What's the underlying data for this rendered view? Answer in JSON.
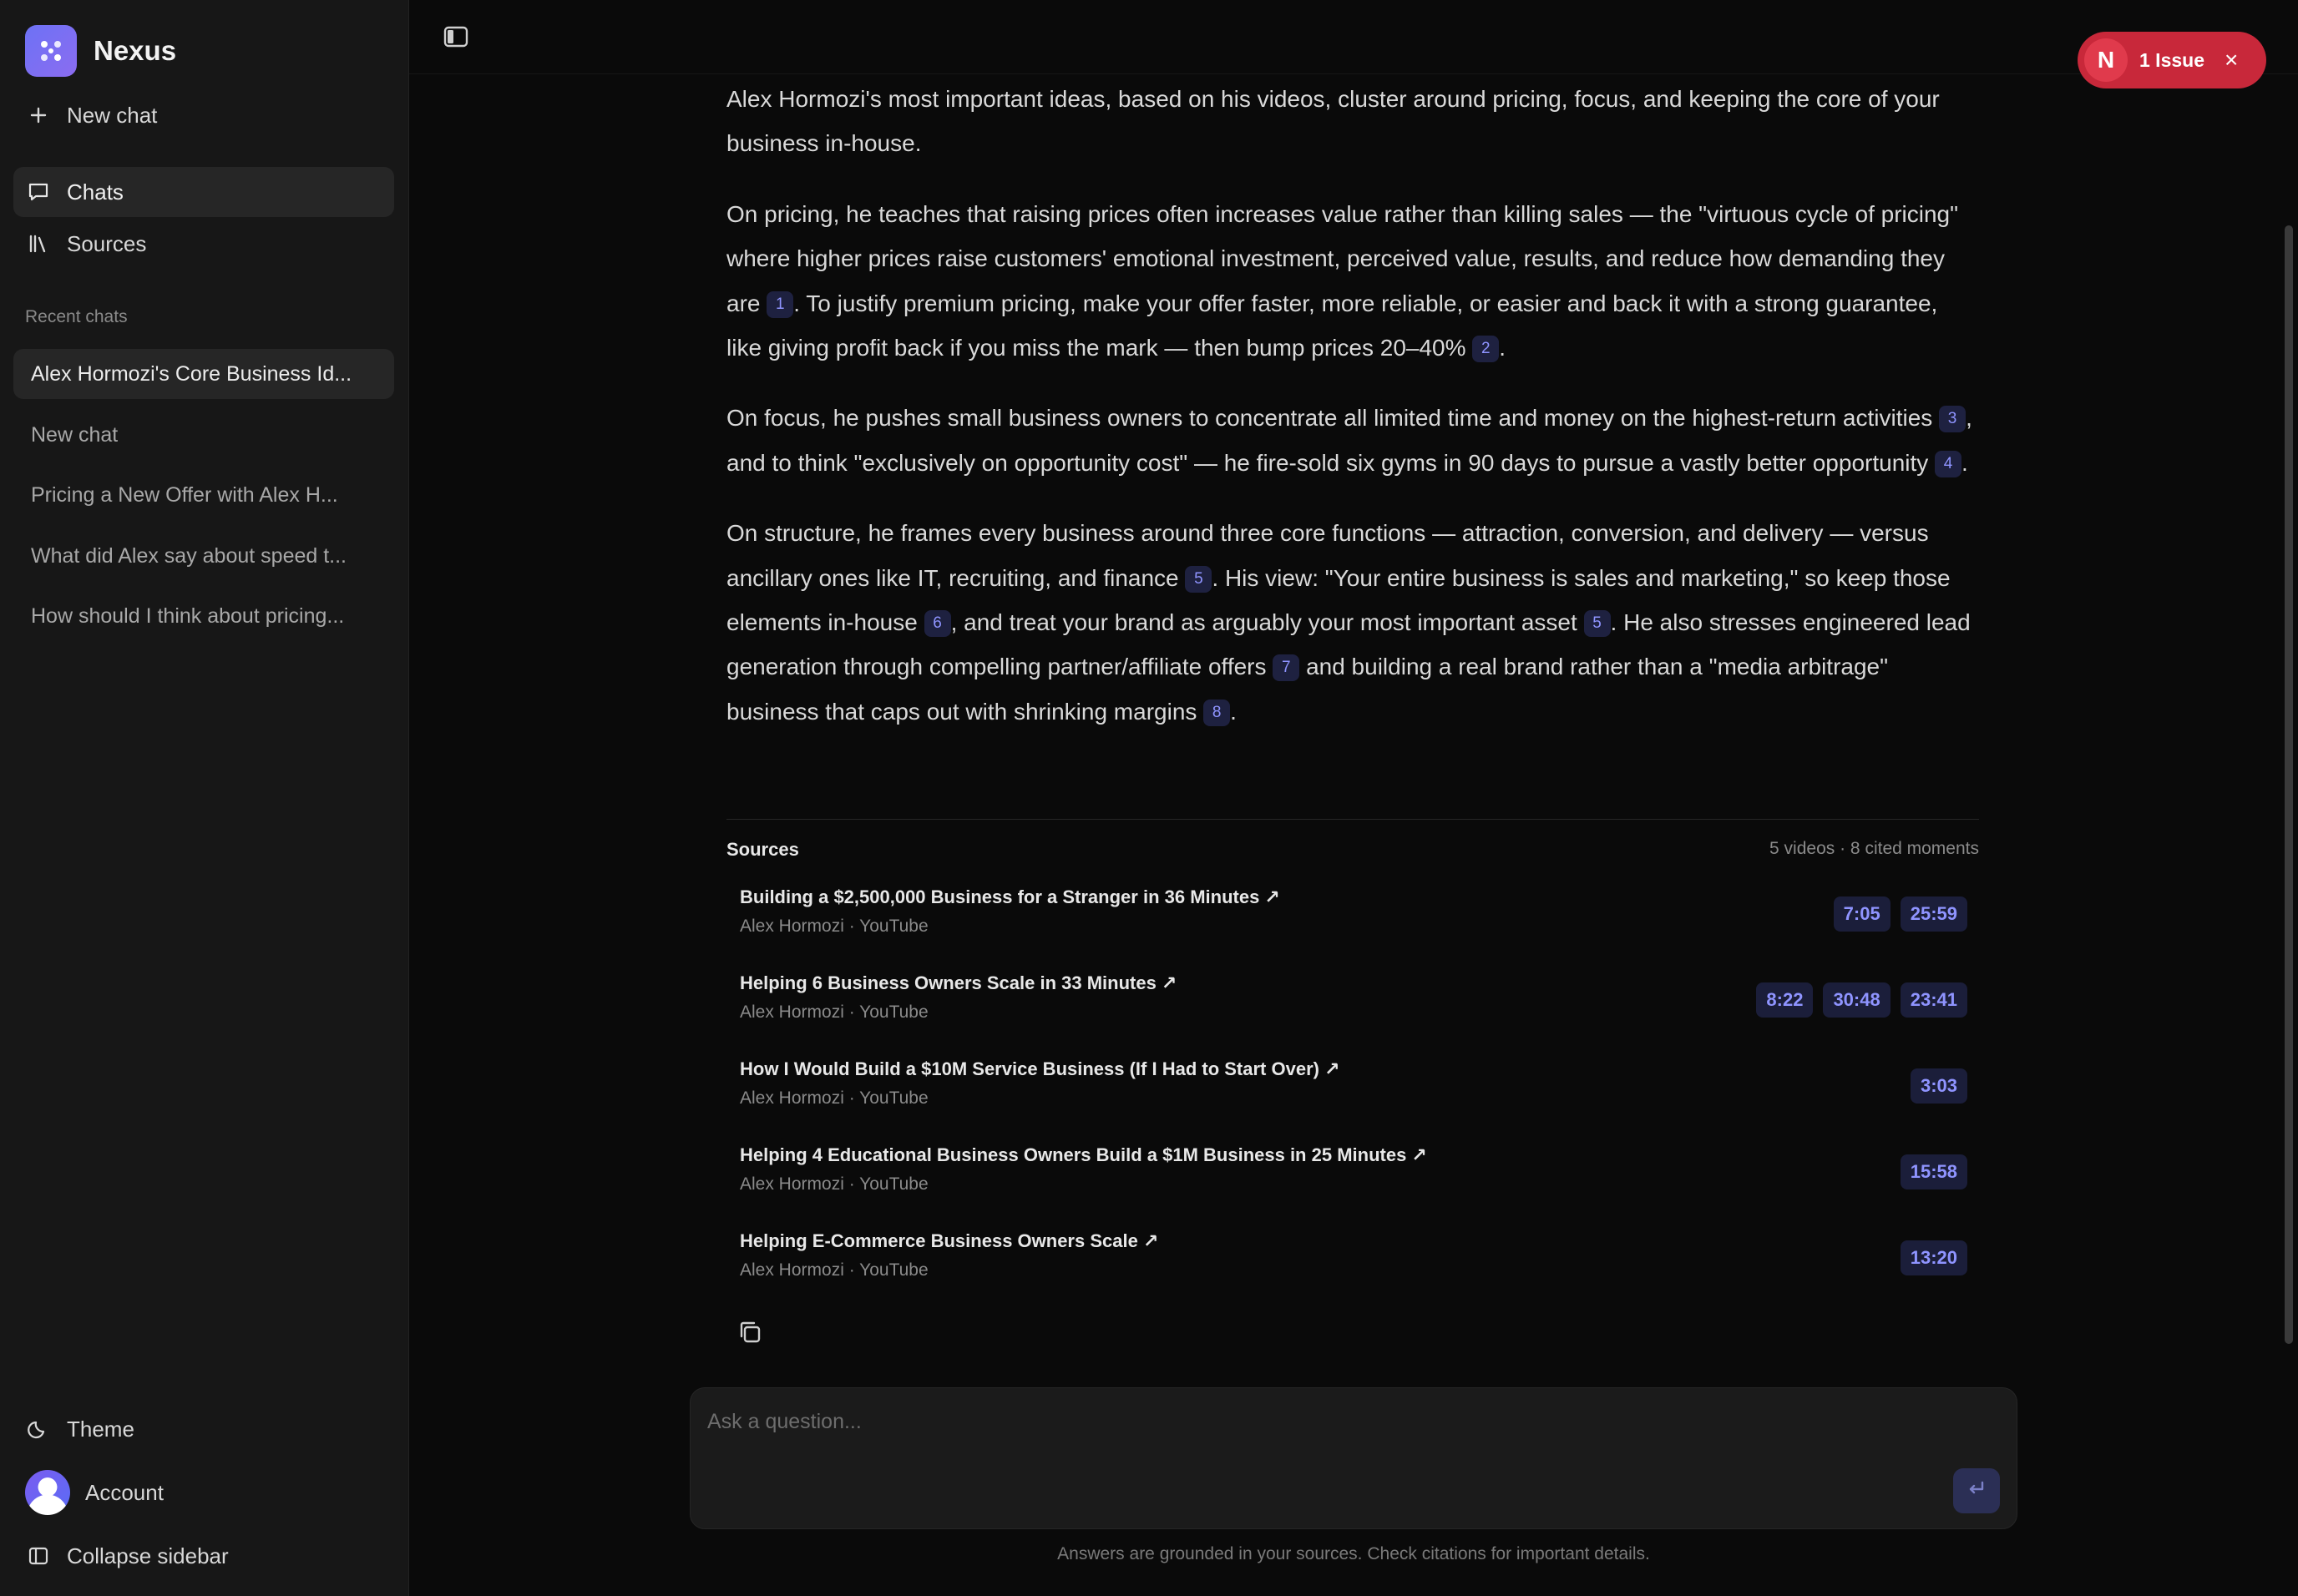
{
  "sidebar": {
    "brand": "Nexus",
    "new_chat": "New chat",
    "nav": [
      {
        "label": "Chats"
      },
      {
        "label": "Sources"
      }
    ],
    "recent_label": "Recent chats",
    "recent": [
      "Alex Hormozi's Core Business Id...",
      "New chat",
      "Pricing a New Offer with Alex H...",
      "What did Alex say about speed t...",
      "How should I think about pricing..."
    ],
    "theme": "Theme",
    "account": "Account",
    "collapse": "Collapse sidebar"
  },
  "issue_badge": {
    "initial": "N",
    "text": "1 Issue",
    "close": "×",
    "color": "#c8283a"
  },
  "answer": {
    "p1": "Alex Hormozi's most important ideas, based on his videos, cluster around pricing, focus, and keeping the core of your business in-house.",
    "p2": [
      "On pricing, he teaches that raising prices often increases value rather than killing sales — the \"virtuous cycle of pricing\" where higher prices raise customers' emotional investment, perceived value, results, and reduce how demanding they are",
      "1",
      ". To justify premium pricing, make your offer faster, more reliable, or easier and back it with a strong guarantee, like giving profit back if you miss the mark — then bump prices 20–40%",
      "2",
      "."
    ],
    "p3": [
      "On focus, he pushes small business owners to concentrate all limited time and money on the highest-return activities",
      "3",
      ", and to think \"exclusively on opportunity cost\" — he fire-sold six gyms in 90 days to pursue a vastly better opportunity",
      "4",
      "."
    ],
    "p4": [
      "On structure, he frames every business around three core functions — attraction, conversion, and delivery — versus ancillary ones like IT, recruiting, and finance",
      "5",
      ". His view: \"Your entire business is sales and marketing,\" so keep those elements in-house",
      "6",
      ", and treat your brand as arguably your most important asset",
      "5",
      ". He also stresses engineered lead generation through compelling partner/affiliate offers",
      "7",
      "and building a real brand rather than a \"media arbitrage\" business that caps out with shrinking margins",
      "8",
      "."
    ]
  },
  "sources": {
    "title": "Sources",
    "meta": "5 videos · 8 cited moments",
    "items": [
      {
        "title": "Building a $2,500,000 Business for a Stranger in 36 Minutes ↗",
        "sub": "Alex Hormozi · YouTube",
        "ts": [
          "7:05",
          "25:59"
        ]
      },
      {
        "title": "Helping 6 Business Owners Scale in 33 Minutes ↗",
        "sub": "Alex Hormozi · YouTube",
        "ts": [
          "8:22",
          "30:48",
          "23:41"
        ]
      },
      {
        "title": "How I Would Build a $10M Service Business (If I Had to Start Over) ↗",
        "sub": "Alex Hormozi · YouTube",
        "ts": [
          "3:03"
        ]
      },
      {
        "title": "Helping 4 Educational Business Owners Build a $1M Business in 25 Minutes ↗",
        "sub": "Alex Hormozi · YouTube",
        "ts": [
          "15:58"
        ]
      },
      {
        "title": "Helping E-Commerce Business Owners Scale ↗",
        "sub": "Alex Hormozi · YouTube",
        "ts": [
          "13:20"
        ]
      }
    ]
  },
  "composer": {
    "placeholder": "Ask a question...",
    "disclaimer": "Answers are grounded in your sources. Check citations for important details."
  },
  "colors": {
    "accent": "#8f94ff",
    "background": "#0a0a0a",
    "sidebar": "#171717"
  }
}
